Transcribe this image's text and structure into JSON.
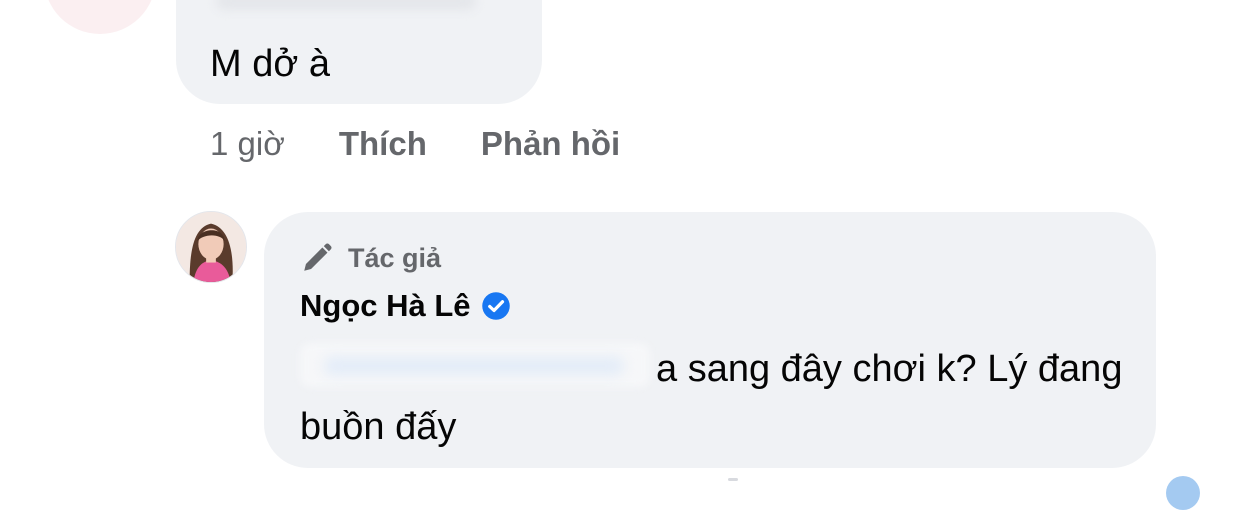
{
  "previous_comment": {
    "text": "M dở à",
    "actions": {
      "time": "1 giờ",
      "like": "Thích",
      "reply": "Phản hồi"
    }
  },
  "reply_comment": {
    "author_badge": "Tác giả",
    "author_name": "Ngọc Hà Lê",
    "verified": true,
    "text_visible": "a sang đây chơi k? Lý đang buồn đấy",
    "badge_icon": "pen-icon",
    "verified_icon": "verified-checkmark-icon"
  },
  "colors": {
    "bubble": "#f0f2f5",
    "secondary_text": "#65676b",
    "primary_text": "#050505",
    "verified_blue": "#1877f2"
  }
}
